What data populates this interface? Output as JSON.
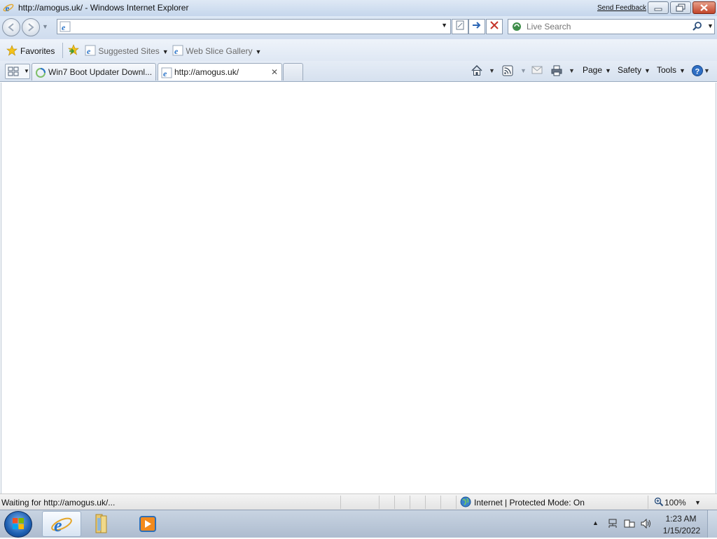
{
  "window": {
    "title": "http://amogus.uk/ - Windows Internet Explorer",
    "send_feedback": "Send Feedback"
  },
  "address_bar": {
    "value": "",
    "placeholder": ""
  },
  "search": {
    "placeholder": "Live Search"
  },
  "favorites_bar": {
    "favorites_label": "Favorites",
    "items": [
      {
        "label": "Suggested Sites",
        "icon": "ie-page-icon"
      },
      {
        "label": "Web Slice Gallery",
        "icon": "ie-page-icon"
      }
    ]
  },
  "tabs": [
    {
      "label": "Win7 Boot Updater Downl...",
      "icon": "loading-icon",
      "active": false
    },
    {
      "label": "http://amogus.uk/",
      "icon": "ie-page-icon",
      "active": true
    }
  ],
  "command_bar": {
    "page_label": "Page",
    "safety_label": "Safety",
    "tools_label": "Tools",
    "help_icon": "help-icon",
    "home_icon": "home-icon",
    "feeds_icon": "feeds-icon",
    "mail_icon": "mail-icon",
    "print_icon": "print-icon"
  },
  "status_bar": {
    "text": "Waiting for http://amogus.uk/...",
    "zone": "Internet | Protected Mode: On",
    "zoom": "100%"
  },
  "taskbar": {
    "time": "1:23 AM",
    "date": "1/15/2022"
  },
  "colors": {
    "accent": "#1d5fb1",
    "close_button": "#c2452a"
  }
}
